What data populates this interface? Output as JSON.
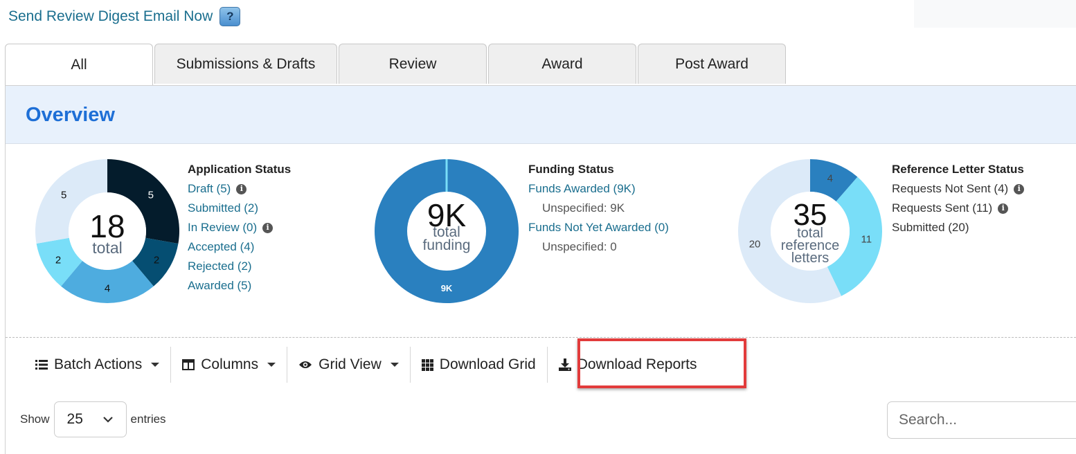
{
  "top": {
    "digest_link": "Send Review Digest Email Now",
    "help_label": "?"
  },
  "tabs": [
    {
      "label": "All"
    },
    {
      "label": "Submissions & Drafts"
    },
    {
      "label": "Review"
    },
    {
      "label": "Award"
    },
    {
      "label": "Post Award"
    }
  ],
  "overview": {
    "title": "Overview"
  },
  "application_status": {
    "center_value": "18",
    "center_label": "total",
    "heading": "Application Status",
    "items": [
      "Draft (5)",
      "Submitted (2)",
      "In Review (0)",
      "Accepted (4)",
      "Rejected (2)",
      "Awarded (5)"
    ],
    "slices": [
      {
        "value": 5,
        "label": "5",
        "color": "#041c2c",
        "text_color": "#ffffff"
      },
      {
        "value": 2,
        "label": "2",
        "color": "#054e72",
        "text_color": "#111111"
      },
      {
        "value": 4,
        "label": "4",
        "color": "#4eacdf",
        "text_color": "#111111"
      },
      {
        "value": 2,
        "label": "2",
        "color": "#79def8",
        "text_color": "#111111"
      },
      {
        "value": 5,
        "label": "5",
        "color": "#dceaf8",
        "text_color": "#111111"
      }
    ]
  },
  "funding_status": {
    "center_value": "9K",
    "center_label_1": "total",
    "center_label_2": "funding",
    "heading": "Funding Status",
    "awarded": "Funds Awarded (9K)",
    "awarded_sub": "Unspecified: 9K",
    "not_awarded": "Funds Not Yet Awarded (0)",
    "not_awarded_sub": "Unspecified: 0",
    "slice_label": "9K",
    "ring_color": "#2a80bf",
    "ring_text_color": "#ffffff"
  },
  "reference_status": {
    "center_value": "35",
    "center_label_1": "total",
    "center_label_2": "reference",
    "center_label_3": "letters",
    "heading": "Reference Letter Status",
    "items": [
      "Requests Not Sent (4)",
      "Requests Sent (11)",
      "Submitted (20)"
    ],
    "slices": [
      {
        "value": 4,
        "label": "4",
        "color": "#2a80bf",
        "text_color": "#444444"
      },
      {
        "value": 11,
        "label": "11",
        "color": "#79def8",
        "text_color": "#444444"
      },
      {
        "value": 20,
        "label": "20",
        "color": "#dceaf8",
        "text_color": "#444444"
      }
    ]
  },
  "toolbar": {
    "batch_actions": "Batch Actions",
    "columns": "Columns",
    "grid_view": "Grid View",
    "download_grid": "Download Grid",
    "download_reports": "Download Reports"
  },
  "table_controls": {
    "show_label": "Show",
    "entries_value": "25",
    "entries_label": "entries",
    "search_placeholder": "Search..."
  }
}
